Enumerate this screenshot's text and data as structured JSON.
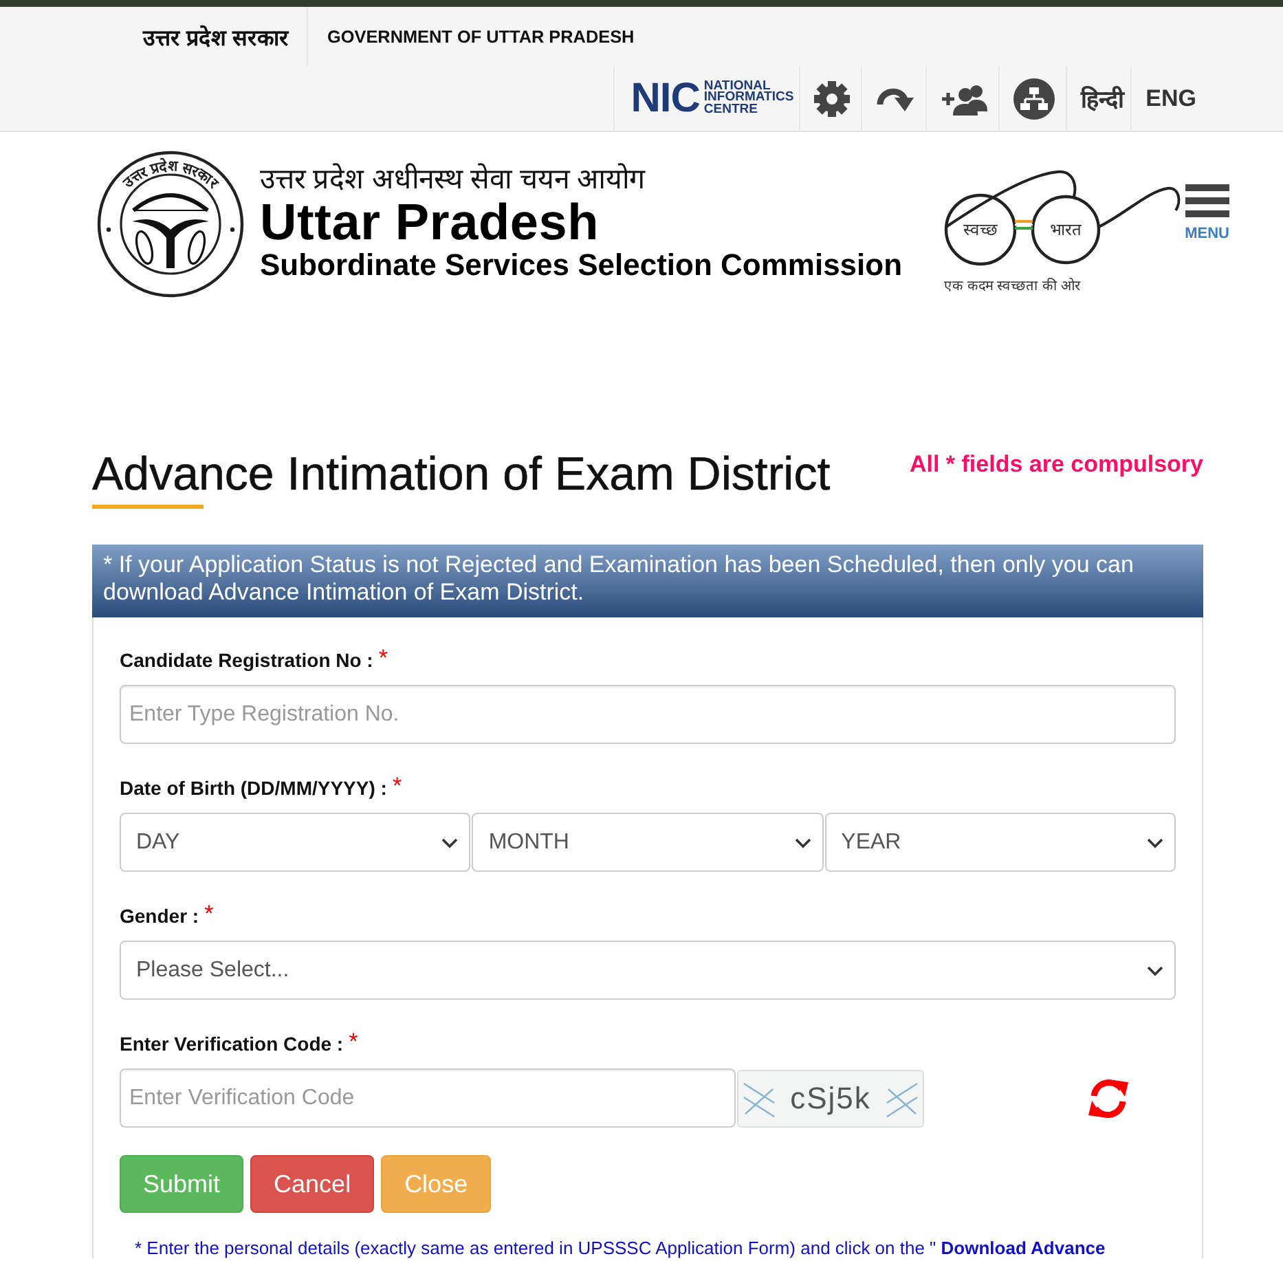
{
  "top_bar": {
    "state_name": "उत्तर प्रदेश सरकार",
    "government": "GOVERNMENT OF UTTAR PRADESH",
    "nic_logo": {
      "mark": "NIC",
      "name_lines": [
        "NATIONAL",
        "INFORMATICS",
        "CENTRE"
      ]
    },
    "tools": [
      {
        "kind": "settings"
      },
      {
        "kind": "skip"
      },
      {
        "kind": "users"
      },
      {
        "kind": "sitemap"
      }
    ],
    "languages": [
      {
        "label": "हिन्दी"
      },
      {
        "label": "ENG"
      }
    ]
  },
  "header": {
    "seal_text": "उत्तर प्रदेश सरकार",
    "hindi_name": "उत्तर प्रदेश अधीनस्थ सेवा चयन आयोग",
    "title": "Uttar Pradesh",
    "subtitle": "Subordinate Services Selection Commission",
    "swachh_logo": {
      "left_word": "स्वच्छ",
      "right_word": "भारत",
      "tagline": "एक कदम स्वच्छता की ओर"
    },
    "menu": {
      "label": "MENU"
    }
  },
  "page": {
    "title": "Advance Intimation of Exam District",
    "required_note": "All * fields are compulsory"
  },
  "form_panel": {
    "notice": "* If your Application Status is not Rejected and Examination has been Scheduled, then only you can download Advance Intimation of Exam District.",
    "fields": [
      {
        "kind": "text",
        "label": "Candidate Registration No :",
        "mark": "*",
        "placeholder": "Enter Type Registration No."
      },
      {
        "kind": "date",
        "label": "Date of Birth (DD/MM/YYYY) :",
        "mark": "*",
        "selects": [
          "DAY",
          "MONTH",
          "YEAR"
        ]
      },
      {
        "kind": "select",
        "label": "Gender :",
        "mark": "*",
        "value": "Please Select..."
      },
      {
        "kind": "captcha",
        "label": "Enter Verification Code :",
        "mark": "*",
        "placeholder": "Enter Verification Code",
        "code": "cSj5k"
      }
    ],
    "buttons": [
      {
        "kind": "submit",
        "label": "Submit"
      },
      {
        "kind": "cancel",
        "label": "Cancel"
      },
      {
        "kind": "close",
        "label": "Close"
      }
    ],
    "instruction": {
      "text": "* Enter the personal details (exactly same as entered in UPSSSC Application Form) and click on the \" ",
      "link": "Download Advance"
    }
  }
}
